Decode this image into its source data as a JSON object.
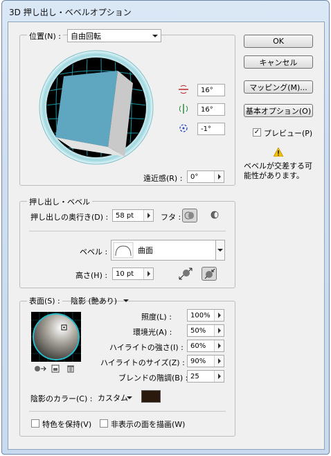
{
  "window": {
    "title": "3D 押し出し・ベベルオプション"
  },
  "position": {
    "label": "位置(N) :",
    "preset": "自由回転",
    "x_value": "16°",
    "y_value": "16°",
    "z_value": "-1°",
    "perspective_label": "遠近感(R) :",
    "perspective_value": "0°"
  },
  "buttons": {
    "ok": "OK",
    "cancel": "キャンセル",
    "mapping": "マッピング(M)...",
    "basic_options": "基本オプション(O)"
  },
  "preview": {
    "label": "プレビュー(P)",
    "checked": true
  },
  "warning": {
    "text": "ベベルが交差する可能性があります。"
  },
  "extrude": {
    "group_label": "押し出し・ベベル",
    "depth_label": "押し出しの奥行き(D) :",
    "depth_value": "58 pt",
    "cap_label": "フタ :",
    "bevel_label": "ベベル :",
    "bevel_value": "曲面",
    "height_label": "高さ(H) :",
    "height_value": "10 pt"
  },
  "surface": {
    "label": "表面(S) :",
    "value": "陰影 (艶あり)",
    "rows": [
      {
        "label": "照度(L) :",
        "value": "100%"
      },
      {
        "label": "環境光(A) :",
        "value": "50%"
      },
      {
        "label": "ハイライトの強さ(I) :",
        "value": "60%"
      },
      {
        "label": "ハイライトのサイズ(Z) :",
        "value": "90%"
      },
      {
        "label": "ブレンドの階調(B) :",
        "value": "25"
      }
    ],
    "shade_color_label": "陰影のカラー(C) :",
    "shade_color_value": "カスタム",
    "shade_color": "#2a1a0e"
  },
  "options": {
    "preserve_spot": "特色を保持(V)",
    "draw_hidden": "非表示の面を描画(W)"
  },
  "colors": {
    "cube_front": "#5fa6c0",
    "grid": "#1fb3c9"
  }
}
